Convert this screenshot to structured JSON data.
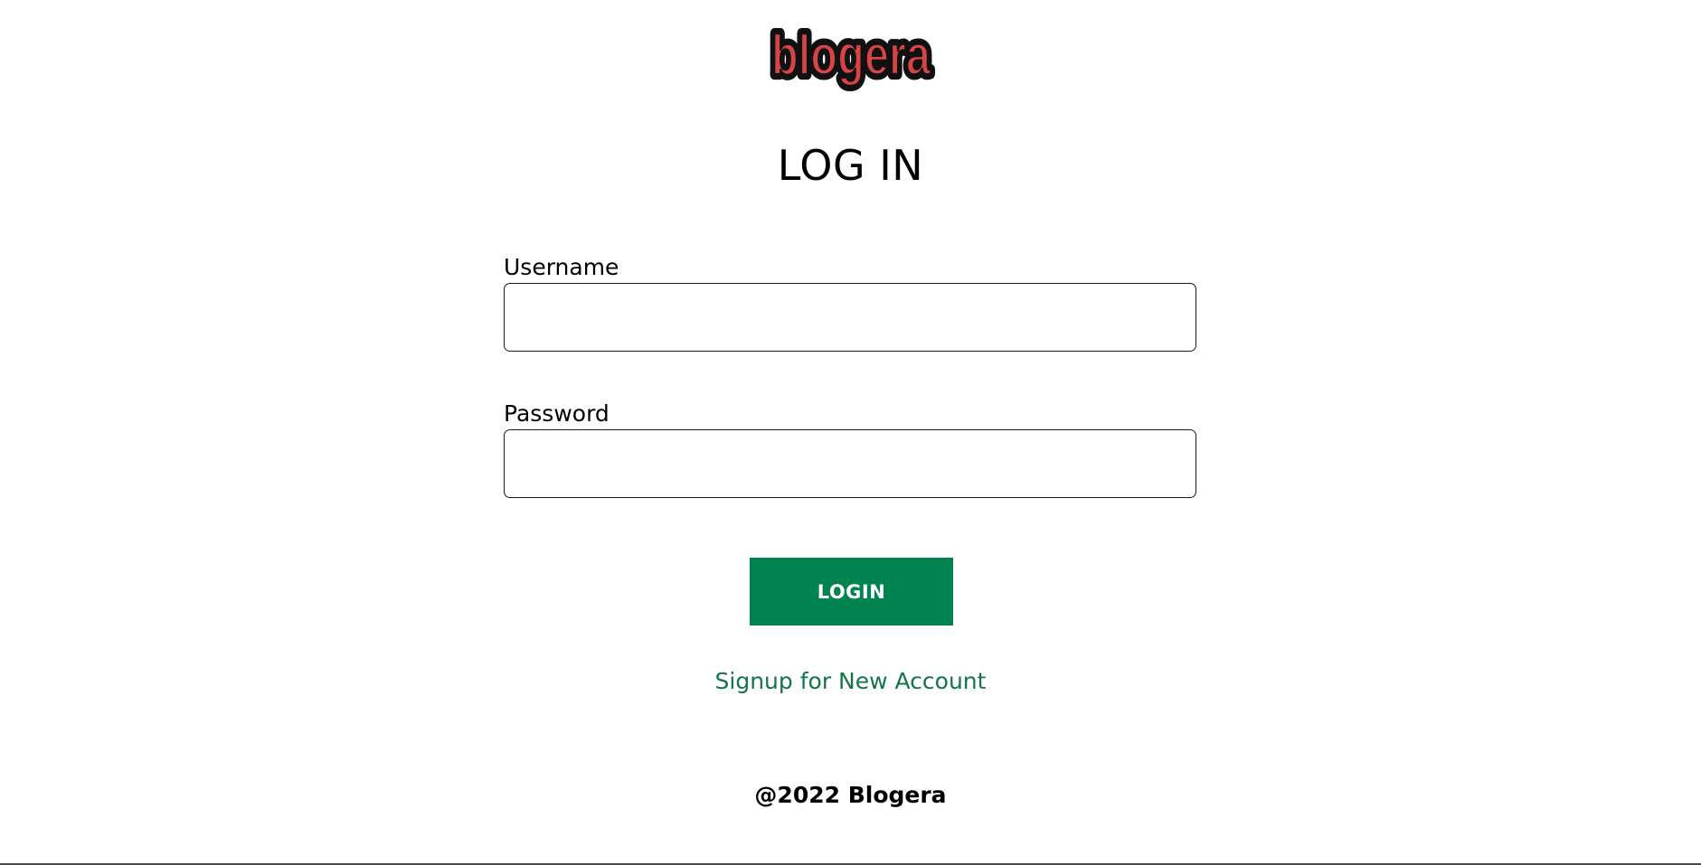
{
  "brand": {
    "logo_text": "blogera",
    "logo_fill": "#d64545",
    "logo_outline": "#111111"
  },
  "page": {
    "title": "LOG IN"
  },
  "form": {
    "username_label": "Username",
    "username_value": "",
    "password_label": "Password",
    "password_value": "",
    "submit_label": "LOGIN"
  },
  "links": {
    "signup_label": "Signup for New Account"
  },
  "footer": {
    "copyright": "@2022 Blogera"
  },
  "colors": {
    "accent": "#00834f",
    "link": "#14754a",
    "text": "#000000",
    "background": "#ffffff"
  }
}
